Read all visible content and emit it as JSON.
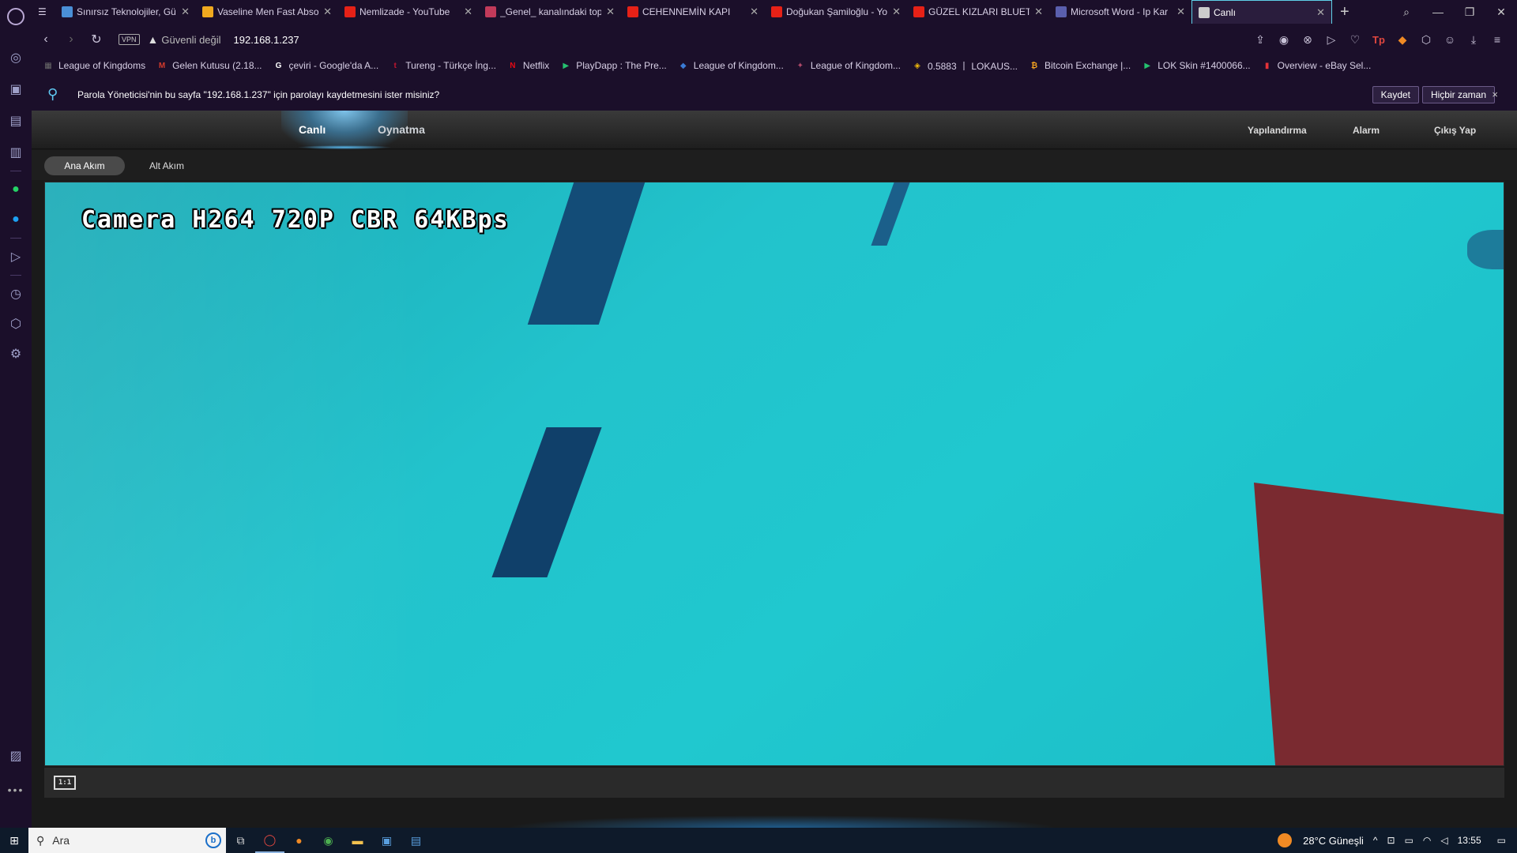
{
  "browser": {
    "tabs": [
      {
        "title": "Sınırsız Teknolojiler, Gü",
        "icon": "triangle-icon",
        "color": "#4a8fd6",
        "active": false
      },
      {
        "title": "Vaseline Men Fast Abso",
        "icon": "spark-icon",
        "color": "#f0a91f",
        "active": false
      },
      {
        "title": "Nemlizade - YouTube",
        "icon": "youtube-icon",
        "color": "#e62117",
        "active": false
      },
      {
        "title": "_Genel_ kanalındaki top",
        "icon": "play-icon",
        "color": "#c23a5a",
        "active": false
      },
      {
        "title": "CEHENNEMİN KAPI",
        "icon": "youtube-icon",
        "color": "#e62117",
        "active": false
      },
      {
        "title": "Doğukan Şamiloğlu - Yo",
        "icon": "youtube-icon",
        "color": "#e62117",
        "active": false
      },
      {
        "title": "GÜZEL KIZLARI BLUETO",
        "icon": "youtube-icon",
        "color": "#e62117",
        "active": false
      },
      {
        "title": "Microsoft Word - Ip Kar",
        "icon": "document-icon",
        "color": "#5a5fae",
        "active": false
      },
      {
        "title": "Canlı",
        "icon": "globe-icon",
        "color": "#cccccc",
        "active": true
      }
    ],
    "address": {
      "vpn_label": "VPN",
      "security_text": "Güvenli değil",
      "url": "192.168.1.237"
    },
    "bookmarks": [
      {
        "label": "League of Kingdoms",
        "color": "#6b6b6b",
        "glyph": "▦"
      },
      {
        "label": "Gelen Kutusu (2.18...",
        "color": "#d33b2c",
        "glyph": "M"
      },
      {
        "label": "çeviri - Google'da A...",
        "color": "#ffffff",
        "glyph": "G"
      },
      {
        "label": "Tureng - Türkçe İng...",
        "color": "#c0152f",
        "glyph": "t"
      },
      {
        "label": "Netflix",
        "color": "#e50914",
        "glyph": "N"
      },
      {
        "label": "PlayDapp : The Pre...",
        "color": "#25c16f",
        "glyph": "▶"
      },
      {
        "label": "League of Kingdom...",
        "color": "#3a7bd5",
        "glyph": "◆"
      },
      {
        "label": "League of Kingdom...",
        "color": "#b04a6a",
        "glyph": "✦"
      },
      {
        "label": "0.5883 丨 LOKAUS...",
        "color": "#f0b90b",
        "glyph": "◈"
      },
      {
        "label": "Bitcoin Exchange |...",
        "color": "#f0a020",
        "glyph": "₿"
      },
      {
        "label": "LOK Skin #1400066...",
        "color": "#25c16f",
        "glyph": "▶"
      },
      {
        "label": "Overview - eBay Sel...",
        "color": "#e53238",
        "glyph": "▮"
      }
    ],
    "password_bar": {
      "message": "Parola Yöneticisi'nin bu sayfa \"192.168.1.237\" için parolayı kaydetmesini ister misiniz?",
      "save_label": "Kaydet",
      "never_label": "Hiçbir zaman",
      "close_glyph": "×"
    }
  },
  "camera_ui": {
    "nav": {
      "live": "Canlı",
      "playback": "Oynatma",
      "config": "Yapılandırma",
      "alarm": "Alarm",
      "logout": "Çıkış Yap"
    },
    "streams": {
      "main": "Ana Akım",
      "sub": "Alt Akım"
    },
    "osd_text": "Camera H264 720P CBR 64KBps",
    "control_icon_label": "1:1",
    "colors": {
      "accent": "#58b8ee",
      "water": "#22c3cc"
    }
  },
  "taskbar": {
    "search_placeholder": "Ara",
    "weather": "28°C  Güneşli",
    "time": "13:55"
  }
}
